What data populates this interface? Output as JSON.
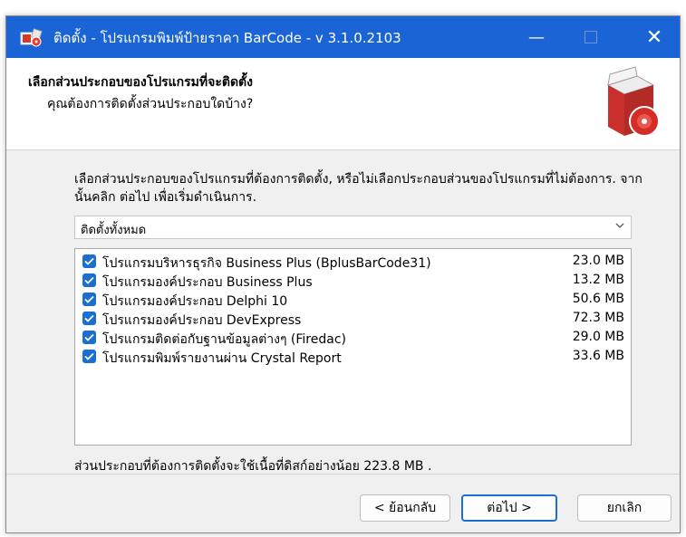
{
  "window": {
    "title": "ติดตั้ง - โปรแกรมพิมพ์ป้ายราคา BarCode - v 3.1.0.2103",
    "controls": {
      "minimize": "—",
      "close": "✕"
    }
  },
  "header": {
    "title": "เลือกส่วนประกอบของโปรแกรมที่จะติดตั้ง",
    "subtitle": "คุณต้องการติดตั้งส่วนประกอบใดบ้าง?"
  },
  "body": {
    "description": "เลือกส่วนประกอบของโปรแกรมที่ต้องการติดตั้ง, หรือไม่เลือกประกอบส่วนของโปรแกรมที่ไม่ต้องการ. จากนั้นคลิก ต่อไป เพื่อเริ่มดำเนินการ.",
    "install_type": {
      "selected": "ติดตั้งทั้งหมด"
    },
    "components": [
      {
        "label": "โปรแกรมบริหารธุรกิจ Business Plus (BplusBarCode31)",
        "size": "23.0 MB",
        "checked": true
      },
      {
        "label": "โปรแกรมองค์ประกอบ Business Plus",
        "size": "13.2 MB",
        "checked": true
      },
      {
        "label": "โปรแกรมองค์ประกอบ Delphi 10",
        "size": "50.6 MB",
        "checked": true
      },
      {
        "label": "โปรแกรมองค์ประกอบ DevExpress",
        "size": "72.3 MB",
        "checked": true
      },
      {
        "label": "โปรแกรมติดต่อกับฐานข้อมูลต่างๆ (Firedac)",
        "size": "29.0 MB",
        "checked": true
      },
      {
        "label": "โปรแกรมพิมพ์รายงานผ่าน Crystal Report",
        "size": "33.6 MB",
        "checked": true
      }
    ],
    "space_note": "ส่วนประกอบที่ต้องการติดตั้งจะใช้เนื้อที่ดิสก์อย่างน้อย 223.8 MB ."
  },
  "buttons": {
    "back": "< ย้อนกลับ",
    "next": "ต่อไป >",
    "cancel": "ยกเลิก"
  },
  "colors": {
    "titlebar": "#1b64d6",
    "checkbox": "#1a6fd1",
    "window_bg": "#f0f0f0"
  },
  "icons": {
    "app": "installer-box-icon",
    "header": "software-box-cd-icon",
    "dropdown": "chevron-down-icon",
    "checkbox": "check-icon"
  }
}
